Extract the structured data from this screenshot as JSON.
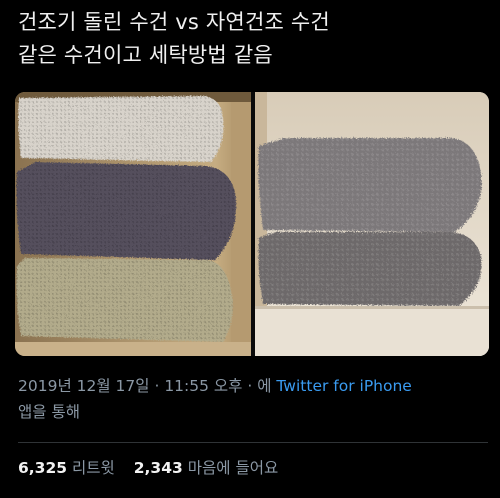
{
  "tweet": {
    "line1": "건조기 돌린 수건 vs 자연건조 수건",
    "line2": "같은 수건이고 세탁방법 같음"
  },
  "media": {
    "left_photo": {
      "icon": "towels-dryer-photo",
      "colors": [
        "#dad5cc",
        "#544f5d",
        "#b2aa8a"
      ]
    },
    "right_photo": {
      "icon": "towels-airdried-photo",
      "colors": [
        "#7b7779",
        "#6c6869"
      ]
    }
  },
  "meta": {
    "date": "2019년 12월 17일",
    "sep1": " · ",
    "time": "11:55 오후",
    "sep2": " · 에 ",
    "source": "Twitter for iPhone",
    "suffix": "앱을 통해"
  },
  "stats": {
    "retweets_count": "6,325",
    "retweets_label": "리트윗",
    "likes_count": "2,343",
    "likes_label": "마음에 들어요"
  },
  "colors": {
    "background": "#000000",
    "text": "#f0f0f0",
    "muted": "#8b98a5",
    "link": "#3a9bf0"
  }
}
